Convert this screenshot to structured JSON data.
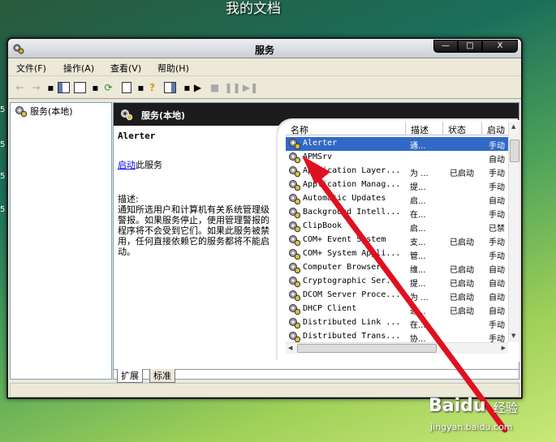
{
  "desktop": {
    "title": "我的文档",
    "edge_marks": [
      "5",
      "5",
      "5",
      "5"
    ]
  },
  "window": {
    "title": "服务",
    "controls": {
      "minimize": "—",
      "maximize": "□",
      "close": "X"
    }
  },
  "menu": [
    "文件(F)",
    "操作(A)",
    "查看(V)",
    "帮助(H)"
  ],
  "toolbar": {
    "icons": [
      "back-arrow-icon",
      "forward-arrow-icon",
      "show-hide-console-tree-icon",
      "properties-icon",
      "refresh-icon",
      "export-list-icon",
      "help-icon",
      "show-hide-action-pane-icon",
      "start-icon",
      "stop-icon",
      "pause-icon",
      "restart-icon"
    ]
  },
  "tree": {
    "root_label": "服务(本地)"
  },
  "panel": {
    "header": "服务(本地)",
    "selected_service": "Alerter",
    "action_link": "启动",
    "action_suffix": "此服务",
    "description_label": "描述:",
    "description": "通知所选用户和计算机有关系统管理级警报。如果服务停止，使用管理警报的程序将不会受到它们。如果此服务被禁用，任何直接依赖它的服务都将不能启动。"
  },
  "list": {
    "columns": [
      "名称",
      "描述",
      "状态",
      "启动"
    ],
    "rows": [
      {
        "name": "Alerter",
        "desc": "通...",
        "status": "",
        "start": "手动",
        "selected": true
      },
      {
        "name": "APMSrv",
        "desc": "",
        "status": "",
        "start": "自动"
      },
      {
        "name": "Application Layer...",
        "desc": "为 ...",
        "status": "已启动",
        "start": "手动"
      },
      {
        "name": "Application Manag...",
        "desc": "提...",
        "status": "",
        "start": "手动"
      },
      {
        "name": "Automatic Updates",
        "desc": "启...",
        "status": "",
        "start": "自动"
      },
      {
        "name": "Background Intell...",
        "desc": "在...",
        "status": "",
        "start": "手动"
      },
      {
        "name": "ClipBook",
        "desc": "启...",
        "status": "",
        "start": "已禁"
      },
      {
        "name": "COM+ Event System",
        "desc": "支...",
        "status": "已启动",
        "start": "手动"
      },
      {
        "name": "COM+ System Appli...",
        "desc": "管...",
        "status": "",
        "start": "手动"
      },
      {
        "name": "Computer Browser",
        "desc": "维...",
        "status": "已启动",
        "start": "自动"
      },
      {
        "name": "Cryptographic Ser...",
        "desc": "提...",
        "status": "已启动",
        "start": "自动"
      },
      {
        "name": "DCOM Server Proce...",
        "desc": "为 ...",
        "status": "已启动",
        "start": "自动"
      },
      {
        "name": "DHCP Client",
        "desc": "通...",
        "status": "已启动",
        "start": "自动"
      },
      {
        "name": "Distributed Link ...",
        "desc": "在...",
        "status": "",
        "start": "手动"
      },
      {
        "name": "Distributed Trans...",
        "desc": "协...",
        "status": "",
        "start": "手动"
      }
    ]
  },
  "tabs": [
    "扩展",
    "标准"
  ],
  "watermark": {
    "brand": "Baidu",
    "product": "经验",
    "url": "jingyan.baidu.com"
  },
  "annotation_color": "#e01020"
}
